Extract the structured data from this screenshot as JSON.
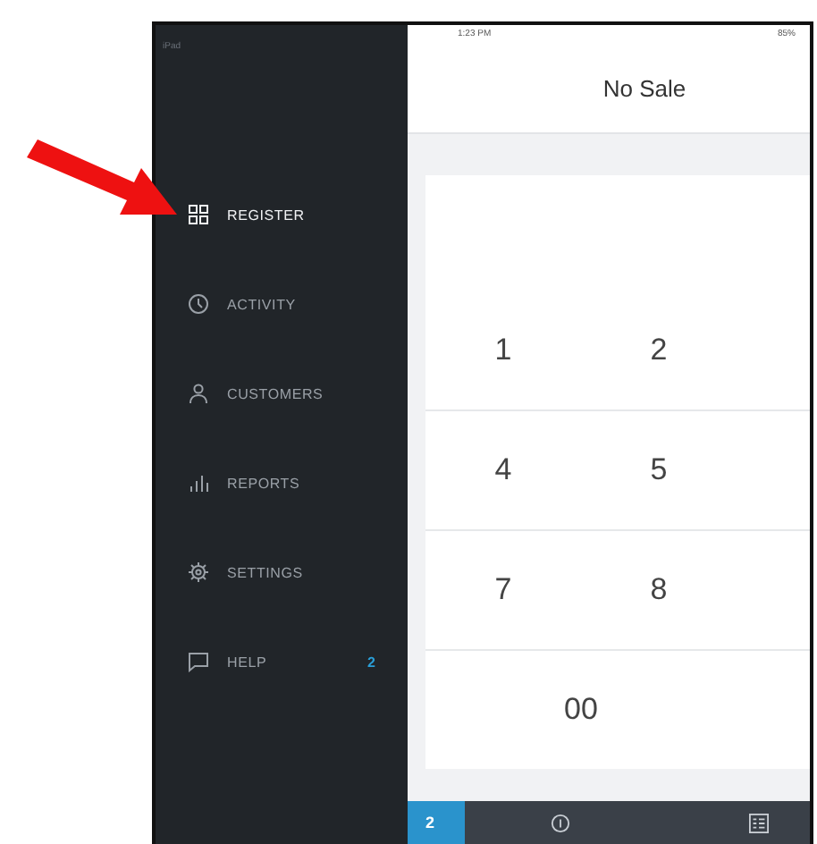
{
  "status_bar": {
    "carrier": "iPad",
    "time": "1:23 PM",
    "battery": "85%"
  },
  "header": {
    "title": "No Sale"
  },
  "sidebar": {
    "items": [
      {
        "label": "REGISTER",
        "selected": true
      },
      {
        "label": "ACTIVITY",
        "selected": false
      },
      {
        "label": "CUSTOMERS",
        "selected": false
      },
      {
        "label": "REPORTS",
        "selected": false
      },
      {
        "label": "SETTINGS",
        "selected": false
      },
      {
        "label": "HELP",
        "selected": false,
        "badge": "2"
      }
    ]
  },
  "keypad": {
    "rows": [
      [
        "1",
        "2"
      ],
      [
        "4",
        "5"
      ],
      [
        "7",
        "8"
      ],
      [
        "00"
      ]
    ]
  },
  "bottom_bar": {
    "ticket_count": "2"
  }
}
